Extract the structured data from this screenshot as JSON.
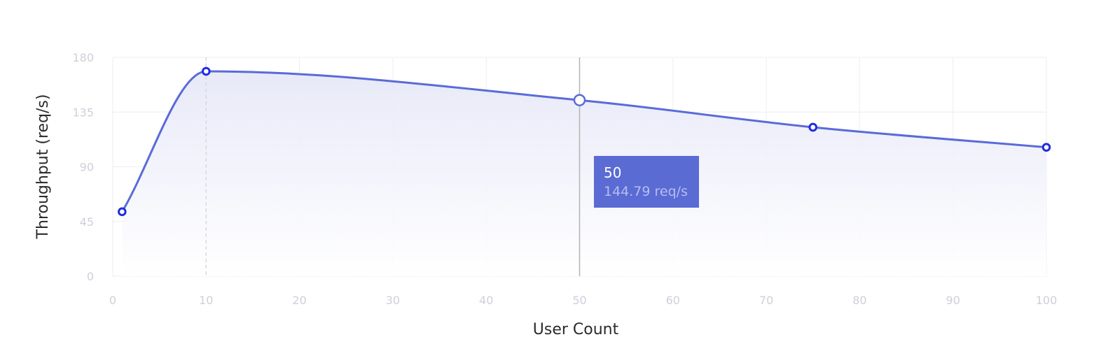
{
  "chart_data": {
    "type": "area",
    "xlabel": "User Count",
    "ylabel": "Throughput (req/s)",
    "xlim": [
      0,
      100
    ],
    "ylim": [
      0,
      180
    ],
    "x_ticks": [
      0,
      10,
      20,
      30,
      40,
      50,
      60,
      70,
      80,
      90,
      100
    ],
    "y_ticks": [
      0,
      45,
      90,
      135,
      180
    ],
    "grid": true,
    "series": [
      {
        "x": [
          1,
          10,
          50,
          75,
          100
        ],
        "y": [
          53,
          168.5,
          144.79,
          122.5,
          106
        ]
      }
    ],
    "peak_marker_x": 10,
    "hover": {
      "x": 50,
      "title": "50",
      "value_text": "144.79 req/s"
    },
    "colors": {
      "line": "#5a6bd8",
      "point_stroke": "#1f2de0",
      "fill_top": "#e6e8f7",
      "grid": "#eeeef3",
      "tooltip_bg": "#5a6bd4",
      "crosshair": "#b3b3b3",
      "peak_line": "#d8d8e0"
    }
  }
}
